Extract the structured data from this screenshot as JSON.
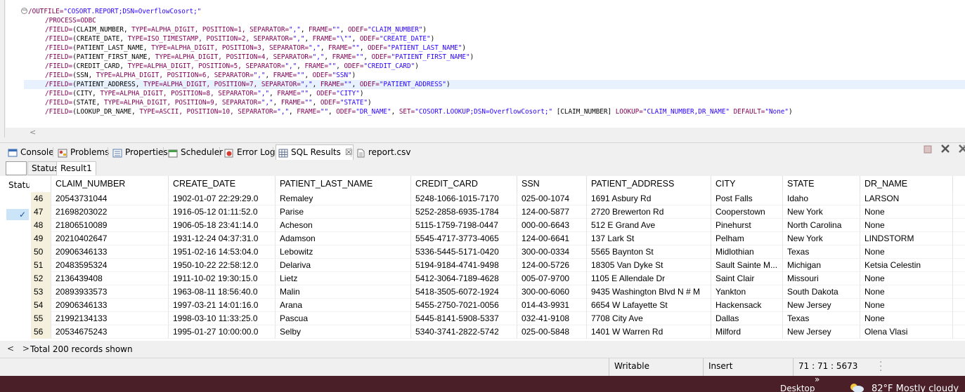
{
  "editor": {
    "lines": [
      {
        "segments": [
          {
            "t": "/OUTFILE=",
            "c": "kw"
          },
          {
            "t": "\"COSORT.REPORT;DSN=OverflowCosort;\"",
            "c": "st"
          }
        ]
      },
      {
        "segments": [
          {
            "t": "/PROCESS=ODBC",
            "c": "kw"
          }
        ]
      },
      {
        "segments": [
          {
            "t": "/FIELD=",
            "c": "kw"
          },
          {
            "t": "(CLAIM_NUMBER, ",
            "c": "pl"
          },
          {
            "t": "TYPE=ALPHA_DIGIT, POSITION=1, SEPARATOR=",
            "c": "kw"
          },
          {
            "t": "\",\"",
            "c": "st"
          },
          {
            "t": ", ",
            "c": "pl"
          },
          {
            "t": "FRAME=",
            "c": "kw"
          },
          {
            "t": "\"\"",
            "c": "st"
          },
          {
            "t": ", ",
            "c": "pl"
          },
          {
            "t": "ODEF=",
            "c": "kw"
          },
          {
            "t": "\"CLAIM_NUMBER\"",
            "c": "st"
          },
          {
            "t": ")",
            "c": "pl"
          }
        ]
      },
      {
        "segments": [
          {
            "t": "/FIELD=",
            "c": "kw"
          },
          {
            "t": "(CREATE_DATE, ",
            "c": "pl"
          },
          {
            "t": "TYPE=ISO_TIMESTAMP, POSITION=2, SEPARATOR=",
            "c": "kw"
          },
          {
            "t": "\",\"",
            "c": "st"
          },
          {
            "t": ", ",
            "c": "pl"
          },
          {
            "t": "FRAME=",
            "c": "kw"
          },
          {
            "t": "\"\\\"\"",
            "c": "st"
          },
          {
            "t": ", ",
            "c": "pl"
          },
          {
            "t": "ODEF=",
            "c": "kw"
          },
          {
            "t": "\"CREATE_DATE\"",
            "c": "st"
          },
          {
            "t": ")",
            "c": "pl"
          }
        ]
      },
      {
        "segments": [
          {
            "t": "/FIELD=",
            "c": "kw"
          },
          {
            "t": "(PATIENT_LAST_NAME, ",
            "c": "pl"
          },
          {
            "t": "TYPE=ALPHA_DIGIT, POSITION=3, SEPARATOR=",
            "c": "kw"
          },
          {
            "t": "\",\"",
            "c": "st"
          },
          {
            "t": ", ",
            "c": "pl"
          },
          {
            "t": "FRAME=",
            "c": "kw"
          },
          {
            "t": "\"\"",
            "c": "st"
          },
          {
            "t": ", ",
            "c": "pl"
          },
          {
            "t": "ODEF=",
            "c": "kw"
          },
          {
            "t": "\"PATIENT_LAST_NAME\"",
            "c": "st"
          },
          {
            "t": ")",
            "c": "pl"
          }
        ]
      },
      {
        "segments": [
          {
            "t": "/FIELD=",
            "c": "kw"
          },
          {
            "t": "(PATIENT_FIRST_NAME, ",
            "c": "pl"
          },
          {
            "t": "TYPE=ALPHA_DIGIT, POSITION=4, SEPARATOR=",
            "c": "kw"
          },
          {
            "t": "\",\"",
            "c": "st"
          },
          {
            "t": ", ",
            "c": "pl"
          },
          {
            "t": "FRAME=",
            "c": "kw"
          },
          {
            "t": "\"\"",
            "c": "st"
          },
          {
            "t": ", ",
            "c": "pl"
          },
          {
            "t": "ODEF=",
            "c": "kw"
          },
          {
            "t": "\"PATIENT_FIRST_NAME\"",
            "c": "st"
          },
          {
            "t": ")",
            "c": "pl"
          }
        ]
      },
      {
        "segments": [
          {
            "t": "/FIELD=",
            "c": "kw"
          },
          {
            "t": "(CREDIT_CARD, ",
            "c": "pl"
          },
          {
            "t": "TYPE=ALPHA_DIGIT, POSITION=5, SEPARATOR=",
            "c": "kw"
          },
          {
            "t": "\",\"",
            "c": "st"
          },
          {
            "t": ", ",
            "c": "pl"
          },
          {
            "t": "FRAME=",
            "c": "kw"
          },
          {
            "t": "\"\"",
            "c": "st"
          },
          {
            "t": ", ",
            "c": "pl"
          },
          {
            "t": "ODEF=",
            "c": "kw"
          },
          {
            "t": "\"CREDIT_CARD\"",
            "c": "st"
          },
          {
            "t": ")",
            "c": "pl"
          }
        ]
      },
      {
        "segments": [
          {
            "t": "/FIELD=",
            "c": "kw"
          },
          {
            "t": "(SSN, ",
            "c": "pl"
          },
          {
            "t": "TYPE=ALPHA_DIGIT, POSITION=6, SEPARATOR=",
            "c": "kw"
          },
          {
            "t": "\",\"",
            "c": "st"
          },
          {
            "t": ", ",
            "c": "pl"
          },
          {
            "t": "FRAME=",
            "c": "kw"
          },
          {
            "t": "\"\"",
            "c": "st"
          },
          {
            "t": ", ",
            "c": "pl"
          },
          {
            "t": "ODEF=",
            "c": "kw"
          },
          {
            "t": "\"SSN\"",
            "c": "st"
          },
          {
            "t": ")",
            "c": "pl"
          }
        ]
      },
      {
        "segments": [
          {
            "t": "/FIELD=",
            "c": "kw"
          },
          {
            "t": "(PATIENT_ADDRESS, ",
            "c": "pl"
          },
          {
            "t": "TYPE=ALPHA_DIGIT, POSITION=7, SEPARATOR=",
            "c": "kw"
          },
          {
            "t": "\",\"",
            "c": "st"
          },
          {
            "t": ", ",
            "c": "pl"
          },
          {
            "t": "FRAME=",
            "c": "kw"
          },
          {
            "t": "\"\"",
            "c": "st"
          },
          {
            "t": ", ",
            "c": "pl"
          },
          {
            "t": "ODEF=",
            "c": "kw"
          },
          {
            "t": "\"PATIENT_ADDRESS\"",
            "c": "st"
          },
          {
            "t": ")",
            "c": "pl"
          }
        ],
        "current": true
      },
      {
        "segments": [
          {
            "t": "/FIELD=",
            "c": "kw"
          },
          {
            "t": "(CITY, ",
            "c": "pl"
          },
          {
            "t": "TYPE=ALPHA_DIGIT, POSITION=8, SEPARATOR=",
            "c": "kw"
          },
          {
            "t": "\",\"",
            "c": "st"
          },
          {
            "t": ", ",
            "c": "pl"
          },
          {
            "t": "FRAME=",
            "c": "kw"
          },
          {
            "t": "\"\"",
            "c": "st"
          },
          {
            "t": ", ",
            "c": "pl"
          },
          {
            "t": "ODEF=",
            "c": "kw"
          },
          {
            "t": "\"CITY\"",
            "c": "st"
          },
          {
            "t": ")",
            "c": "pl"
          }
        ]
      },
      {
        "segments": [
          {
            "t": "/FIELD=",
            "c": "kw"
          },
          {
            "t": "(STATE, ",
            "c": "pl"
          },
          {
            "t": "TYPE=ALPHA_DIGIT, POSITION=9, SEPARATOR=",
            "c": "kw"
          },
          {
            "t": "\",\"",
            "c": "st"
          },
          {
            "t": ", ",
            "c": "pl"
          },
          {
            "t": "FRAME=",
            "c": "kw"
          },
          {
            "t": "\"\"",
            "c": "st"
          },
          {
            "t": ", ",
            "c": "pl"
          },
          {
            "t": "ODEF=",
            "c": "kw"
          },
          {
            "t": "\"STATE\"",
            "c": "st"
          },
          {
            "t": ")",
            "c": "pl"
          }
        ]
      },
      {
        "segments": [
          {
            "t": "/FIELD=",
            "c": "kw"
          },
          {
            "t": "(LOOKUP_DR_NAME, ",
            "c": "pl"
          },
          {
            "t": "TYPE=ASCII, POSITION=10, SEPARATOR=",
            "c": "kw"
          },
          {
            "t": "\",\"",
            "c": "st"
          },
          {
            "t": ", ",
            "c": "pl"
          },
          {
            "t": "FRAME=",
            "c": "kw"
          },
          {
            "t": "\"\"",
            "c": "st"
          },
          {
            "t": ", ",
            "c": "pl"
          },
          {
            "t": "ODEF=",
            "c": "kw"
          },
          {
            "t": "\"DR_NAME\"",
            "c": "st"
          },
          {
            "t": ", ",
            "c": "pl"
          },
          {
            "t": "SET=",
            "c": "kw"
          },
          {
            "t": "\"COSORT.LOOKUP;DSN=OverflowCosort;\"",
            "c": "st"
          },
          {
            "t": " [CLAIM_NUMBER] ",
            "c": "pl"
          },
          {
            "t": "LOOKUP=",
            "c": "kw"
          },
          {
            "t": "\"CLAIM_NUMBER,DR_NAME\"",
            "c": "st"
          },
          {
            "t": " ",
            "c": "pl"
          },
          {
            "t": "DEFAULT=",
            "c": "kw"
          },
          {
            "t": "\"None\"",
            "c": "st"
          },
          {
            "t": ")",
            "c": "pl"
          }
        ]
      }
    ],
    "fold_glyph": "−",
    "hscroll_left": "<"
  },
  "views": {
    "tabs": [
      {
        "key": "console",
        "label": "Console",
        "icon": "console-icon"
      },
      {
        "key": "problems",
        "label": "Problems",
        "icon": "problems-icon"
      },
      {
        "key": "properties",
        "label": "Properties",
        "icon": "properties-icon"
      },
      {
        "key": "scheduler",
        "label": "Scheduler",
        "icon": "scheduler-icon"
      },
      {
        "key": "error-log",
        "label": "Error Log",
        "icon": "error-log-icon"
      },
      {
        "key": "sql-results",
        "label": "SQL Results",
        "icon": "sql-results-icon",
        "active": true,
        "closable": true
      },
      {
        "key": "report-csv",
        "label": "report.csv",
        "icon": "file-icon"
      }
    ],
    "close_glyph": "☒"
  },
  "results": {
    "sub_tabs": [
      "Status",
      "Result1"
    ],
    "status_col_header": "Status",
    "checkmark": "✓",
    "columns": [
      "CLAIM_NUMBER",
      "CREATE_DATE",
      "PATIENT_LAST_NAME",
      "CREDIT_CARD",
      "SSN",
      "PATIENT_ADDRESS",
      "CITY",
      "STATE",
      "DR_NAME"
    ],
    "rows": [
      {
        "n": "46",
        "cells": [
          "20543731044",
          "1902-01-07 22:29:29.0",
          "Remaley",
          "5248-1066-1015-7170",
          "025-00-1074",
          "1691 Asbury Rd",
          "Post Falls",
          "Idaho",
          "LARSON"
        ]
      },
      {
        "n": "47",
        "cells": [
          "21698203022",
          "1916-05-12 01:11:52.0",
          "Parise",
          "5252-2858-6935-1784",
          "124-00-5877",
          "2720 Brewerton Rd",
          "Cooperstown",
          "New York",
          "None"
        ]
      },
      {
        "n": "48",
        "cells": [
          "21806510089",
          "1906-05-18 23:41:14.0",
          "Acheson",
          "5115-1759-7198-0447",
          "000-00-6643",
          "512 E Grand Ave",
          "Pinehurst",
          "North Carolina",
          "None"
        ]
      },
      {
        "n": "49",
        "cells": [
          "20210402647",
          "1931-12-24 04:37:31.0",
          "Adamson",
          "5545-4717-3773-4065",
          "124-00-6641",
          "137 Lark St",
          "Pelham",
          "New York",
          "LINDSTORM"
        ]
      },
      {
        "n": "50",
        "cells": [
          "20906346133",
          "1951-02-16 14:53:04.0",
          "Lebowitz",
          "5336-5445-5171-0420",
          "300-00-0334",
          "5565 Baynton St",
          "Midlothian",
          "Texas",
          "None"
        ]
      },
      {
        "n": "51",
        "cells": [
          "20483595324",
          "1950-10-22 22:58:12.0",
          "Delariva",
          "5194-9184-4741-9498",
          "124-00-5726",
          "18305 Van Dyke St",
          "Sault Sainte M...",
          "Michigan",
          "Ketsia Celestin"
        ]
      },
      {
        "n": "52",
        "cells": [
          "2136439408",
          "1911-10-02 19:30:15.0",
          "Lietz",
          "5412-3064-7189-4628",
          "005-07-9700",
          "1105 E Allendale Dr",
          "Saint Clair",
          "Missouri",
          "None"
        ]
      },
      {
        "n": "53",
        "cells": [
          "20893933573",
          "1963-08-11 18:56:40.0",
          "Malin",
          "5418-3505-6072-1924",
          "300-00-6060",
          "9435 Washington Blvd N # M",
          "Yankton",
          "South Dakota",
          "None"
        ]
      },
      {
        "n": "54",
        "cells": [
          "20906346133",
          "1997-03-21 14:01:16.0",
          "Arana",
          "5455-2750-7021-0056",
          "014-43-9931",
          "6654 W Lafayette St",
          "Hackensack",
          "New Jersey",
          "None"
        ]
      },
      {
        "n": "55",
        "cells": [
          "21992134133",
          "1998-03-10 11:33:25.0",
          "Pascua",
          "5445-8141-5908-5337",
          "032-41-9108",
          "7708 City Ave",
          "Dallas",
          "Texas",
          "None"
        ]
      },
      {
        "n": "56",
        "cells": [
          "20534675243",
          "1995-01-27 10:00:00.0",
          "Selby",
          "5340-3741-2822-5742",
          "025-00-5848",
          "1401 W Warren Rd",
          "Milford",
          "New Jersey",
          "Olena Vlasi"
        ]
      }
    ],
    "nav_arrows": "< >",
    "records_text": "Total 200 records shown"
  },
  "statusbar": {
    "writable": "Writable",
    "insert": "Insert",
    "position": "71 : 71 : 5673"
  },
  "taskbar": {
    "chevron": "»",
    "desktop": "Desktop",
    "weather": "82°F  Mostly cloudy"
  },
  "colors": {
    "keyword": "#7f0055",
    "string": "#2a00ff",
    "taskbar": "#4a1f28",
    "rownum_bg": "#f5f0dd"
  }
}
